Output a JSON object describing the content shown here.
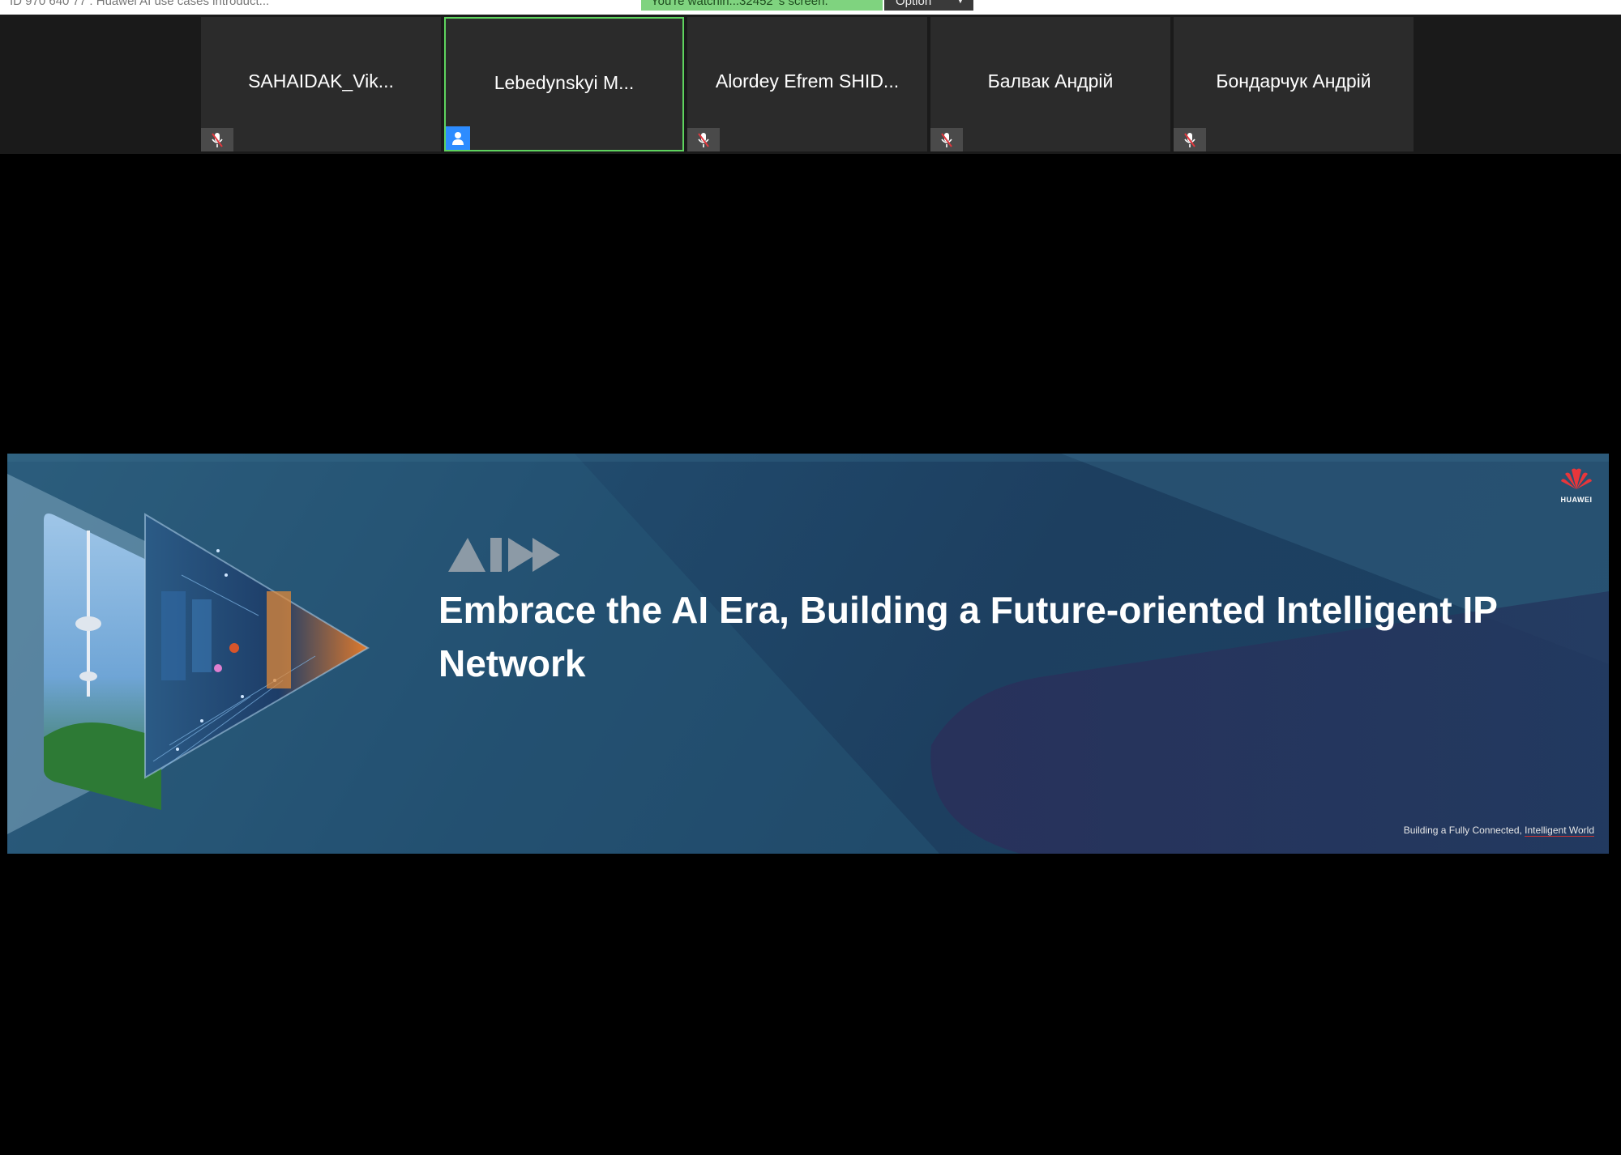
{
  "window": {
    "meeting_title": "ID 970 640 77 : Huawei AI use cases introduct...",
    "watching_banner": "You're watchin...32452 's screen.",
    "option_label": "Option",
    "option_chevron": "chevron-down-icon"
  },
  "participants": [
    {
      "name": "SAHAIDAK_Vik...",
      "muted": true,
      "active_speaker": false
    },
    {
      "name": "Lebedynskyi M...",
      "muted": false,
      "active_speaker": true
    },
    {
      "name": "Alordey Efrem SHID...",
      "muted": true,
      "active_speaker": false
    },
    {
      "name": "Балвак Андрій",
      "muted": true,
      "active_speaker": false
    },
    {
      "name": "Бондарчук Андрій",
      "muted": true,
      "active_speaker": false
    }
  ],
  "shared_slide": {
    "headline_line1": "Embrace the AI Era, Building a Future-oriented Intelligent IP",
    "headline_line2": "Network",
    "footer_part1": "Building a Fully Connected, ",
    "footer_part2": "Intelligent World",
    "brand": "HUAWEI",
    "logo_icon": "huawei-flower-icon",
    "ai_logo_icon": "ai-play-logo-icon"
  },
  "colors": {
    "active_speaker_border": "#5ed35e",
    "watch_banner_bg": "#7fd37f",
    "avatar_badge_bg": "#2d8cff",
    "slide_bg": "#1d3f60"
  }
}
